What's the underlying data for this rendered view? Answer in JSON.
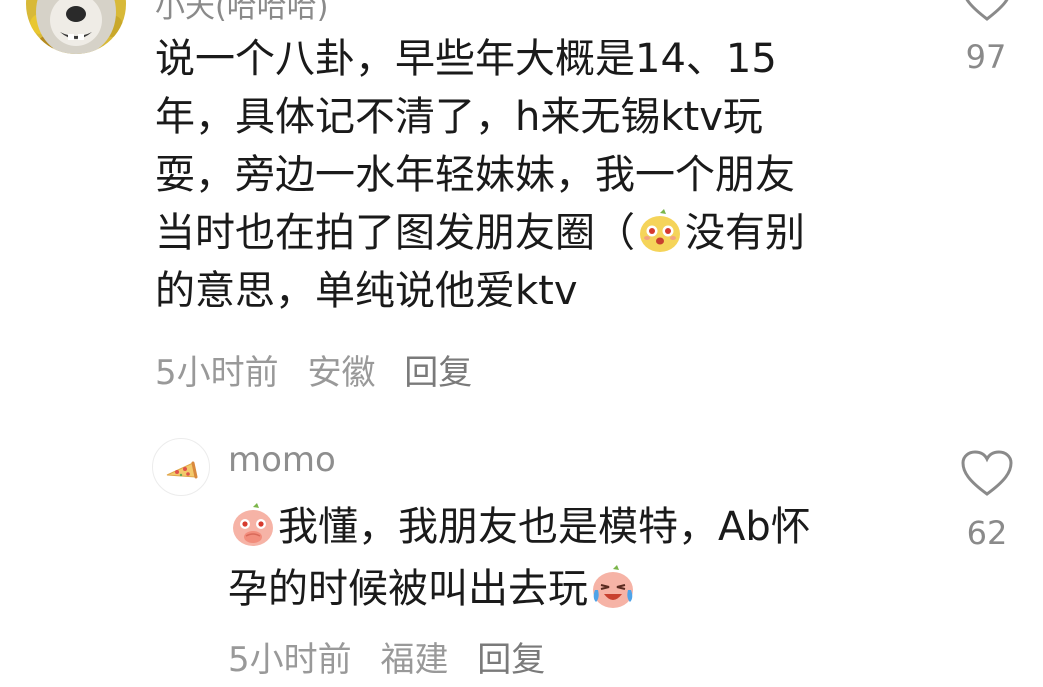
{
  "comment": {
    "username": "小天(哈哈哈)",
    "text_lines": [
      "说一个八卦，早些年大概是14、15",
      "年，具体记不清了，h来无锡ktv玩",
      "耍，旁边一水年轻妹妹，我一个朋友",
      "当时也在拍了图发朋友圈（",
      "没有别",
      "的意思，单纯说他爱ktv"
    ],
    "inline_emoji": "surprised-blob-emoji",
    "time": "5小时前",
    "location": "安徽",
    "reply_label": "回复",
    "likes": "97",
    "avatar_icon": "dog-avatar-icon"
  },
  "reply": {
    "username": "momo",
    "text_lines": [
      "我懂，我朋友也是模特，Ab怀",
      "孕的时候被叫出去玩"
    ],
    "leading_emoji": "covering-mouth-blob-emoji",
    "trailing_emoji": "laughing-tears-blob-emoji",
    "time": "5小时前",
    "location": "福建",
    "reply_label": "回复",
    "likes": "62",
    "avatar_icon": "pizza-avatar-icon"
  },
  "colors": {
    "text": "#1a1a1a",
    "meta": "#999999",
    "icon_gray": "#8a8a8a",
    "background": "#ffffff"
  }
}
